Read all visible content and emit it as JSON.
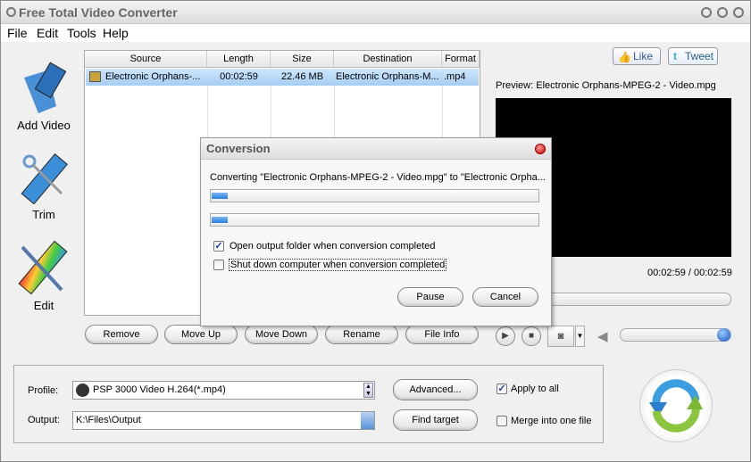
{
  "app": {
    "title": "Free Total Video Converter"
  },
  "menu": [
    "File",
    "Edit",
    "Tools",
    "Help"
  ],
  "sidebar": [
    {
      "label": "Add Video",
      "icon": "add-video-icon"
    },
    {
      "label": "Trim",
      "icon": "scissors-film-icon"
    },
    {
      "label": "Edit",
      "icon": "brush-film-icon"
    }
  ],
  "list": {
    "columns": [
      "Source",
      "Length",
      "Size",
      "Destination",
      "Format"
    ],
    "rows": [
      {
        "source": "Electronic Orphans-...",
        "length": "00:02:59",
        "size": "22.46 MB",
        "destination": "Electronic Orphans-M...",
        "format": ".mp4"
      }
    ]
  },
  "list_buttons": [
    "Remove",
    "Move Up",
    "Move Down",
    "Rename",
    "File Info"
  ],
  "social": {
    "like": "Like",
    "tweet": "Tweet"
  },
  "preview": {
    "label": "Preview: Electronic Orphans-MPEG-2 - Video.mpg",
    "time": "00:02:59 / 00:02:59",
    "volume_percent": 100
  },
  "dialog": {
    "title": "Conversion",
    "message": "Converting \"Electronic Orphans-MPEG-2 - Video.mpg\" to \"Electronic Orpha...",
    "progress_file_percent": 5,
    "progress_total_percent": 5,
    "open_folder": {
      "label": "Open output folder when conversion completed",
      "checked": true
    },
    "shutdown": {
      "label": "Shut down computer when conversion completed",
      "checked": false
    },
    "pause": "Pause",
    "cancel": "Cancel"
  },
  "settings": {
    "profile_label": "Profile:",
    "profile_value": "PSP 3000 Video H.264(*.mp4)",
    "output_label": "Output:",
    "output_value": "K:\\Files\\Output",
    "advanced": "Advanced...",
    "find_target": "Find target",
    "apply_all": {
      "label": "Apply to all",
      "checked": true
    },
    "merge": {
      "label": "Merge into one file",
      "checked": false
    }
  },
  "colors": {
    "selection": "#a6cdf3",
    "progress": "#2a7de0",
    "convert_blue": "#3a9ee0",
    "convert_green": "#8cc63f"
  }
}
